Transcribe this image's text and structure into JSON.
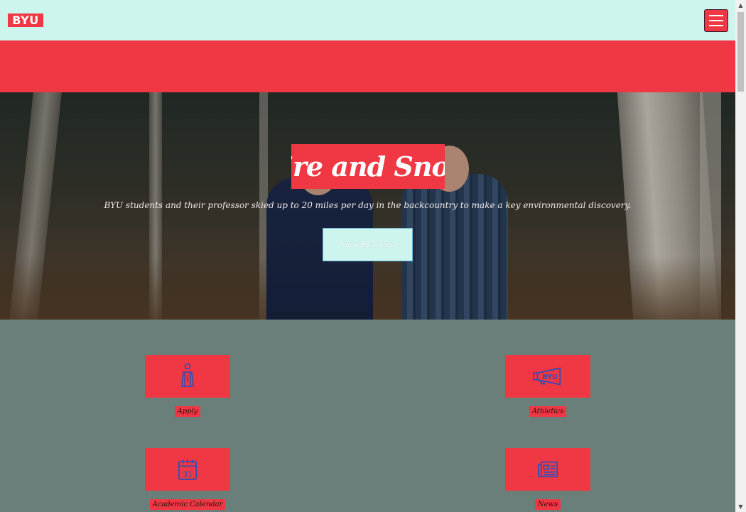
{
  "header": {
    "logo_text": "BYU",
    "menu_icon": "hamburger-menu-icon"
  },
  "hero": {
    "title": "Fire and Snow",
    "subtitle": "BYU students and their professor skied up to 20 miles per day in the backcountry to make a key environmental discovery.",
    "cta_label": "View BYU.edu"
  },
  "quick_links": [
    {
      "label": "Apply",
      "icon": "graduate-icon"
    },
    {
      "label": "Athletics",
      "icon": "megaphone-icon"
    },
    {
      "label": "Academic Calendar",
      "icon": "calendar-icon",
      "icon_text": "31"
    },
    {
      "label": "News",
      "icon": "newspaper-icon"
    }
  ],
  "colors": {
    "accent_red": "#f03744",
    "header_bg": "#cdf5ee",
    "section_bg": "#6b7f7a",
    "icon_blue": "#2b4fb8"
  }
}
